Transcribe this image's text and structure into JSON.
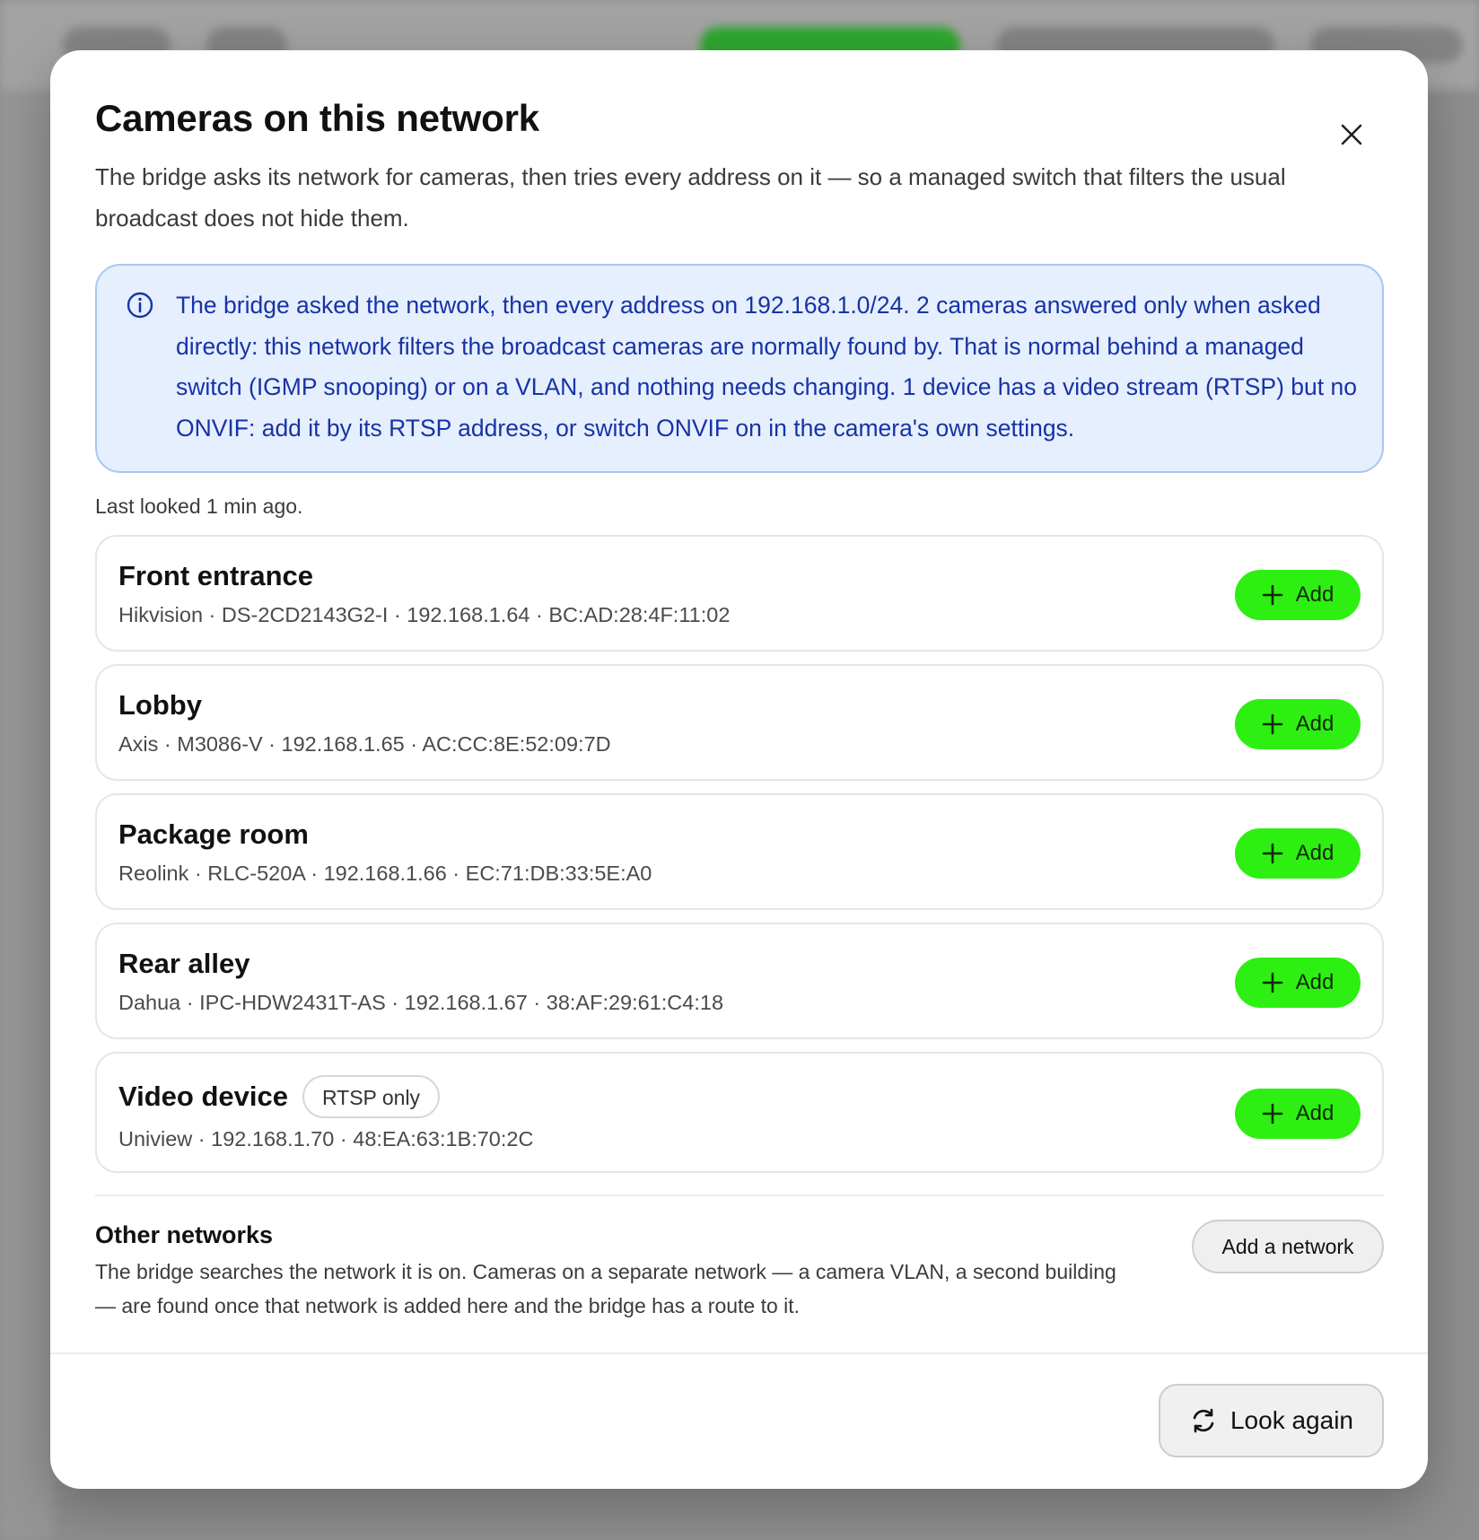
{
  "colors": {
    "accent_green": "#2eef12",
    "info_bg": "#e6effd",
    "info_border": "#a9c6f2",
    "info_text": "#1733a6"
  },
  "modal": {
    "title": "Cameras on this network",
    "subtitle": "The bridge asks its network for cameras, then tries every address on it — so a managed switch that filters the usual broadcast does not hide them.",
    "close_icon": "close-icon"
  },
  "info": {
    "icon": "info-icon",
    "text": "The bridge asked the network, then every address on 192.168.1.0/24. 2 cameras answered only when asked directly: this network filters the broadcast cameras are normally found by. That is normal behind a managed switch (IGMP snooping) or on a VLAN, and nothing needs changing. 1 device has a video stream (RTSP) but no ONVIF: add it by its RTSP address, or switch ONVIF on in the camera's own settings."
  },
  "last_looked": "Last looked 1 min ago.",
  "cameras": [
    {
      "name": "Front entrance",
      "meta": "Hikvision · DS-2CD2143G2-I · 192.168.1.64 · BC:AD:28:4F:11:02",
      "add_label": "Add"
    },
    {
      "name": "Lobby",
      "meta": "Axis · M3086-V · 192.168.1.65 · AC:CC:8E:52:09:7D",
      "add_label": "Add"
    },
    {
      "name": "Package room",
      "meta": "Reolink · RLC-520A · 192.168.1.66 · EC:71:DB:33:5E:A0",
      "add_label": "Add"
    },
    {
      "name": "Rear alley",
      "meta": "Dahua · IPC-HDW2431T-AS · 192.168.1.67 · 38:AF:29:61:C4:18",
      "add_label": "Add"
    },
    {
      "name": "Video device",
      "badge": "RTSP only",
      "meta": "Uniview · 192.168.1.70 · 48:EA:63:1B:70:2C",
      "add_label": "Add"
    }
  ],
  "other_networks": {
    "title": "Other networks",
    "description": "The bridge searches the network it is on. Cameras on a separate network — a camera VLAN, a second building — are found once that network is added here and the bridge has a route to it.",
    "button_label": "Add a network"
  },
  "footer": {
    "look_again_label": "Look again",
    "icon": "refresh-icon"
  }
}
